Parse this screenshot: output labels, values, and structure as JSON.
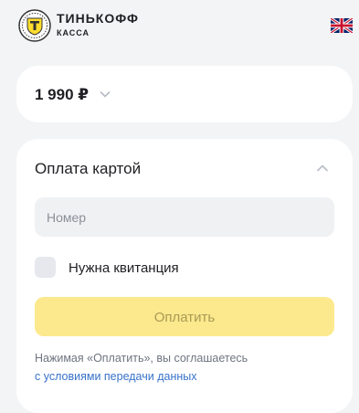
{
  "brand": {
    "name": "ТИНЬКОФФ",
    "subtitle": "КАССА",
    "logo_icon": "tinkoff-shield-logo",
    "flag_icon": "uk-flag-icon"
  },
  "amount": {
    "value": "1 990 ₽",
    "chevron_icon": "chevron-down-icon"
  },
  "payment": {
    "title": "Оплата картой",
    "collapse_icon": "chevron-up-icon",
    "card_number_placeholder": "Номер",
    "receipt_label": "Нужна квитанция",
    "receipt_checked": false,
    "pay_button_label": "Оплатить",
    "terms_text": "Нажимая «Оплатить», вы соглашаетесь",
    "terms_link": "с условиями передачи данных"
  },
  "colors": {
    "accent_yellow": "#fce98d",
    "link_blue": "#3772c9",
    "background": "#f3f4f6"
  }
}
